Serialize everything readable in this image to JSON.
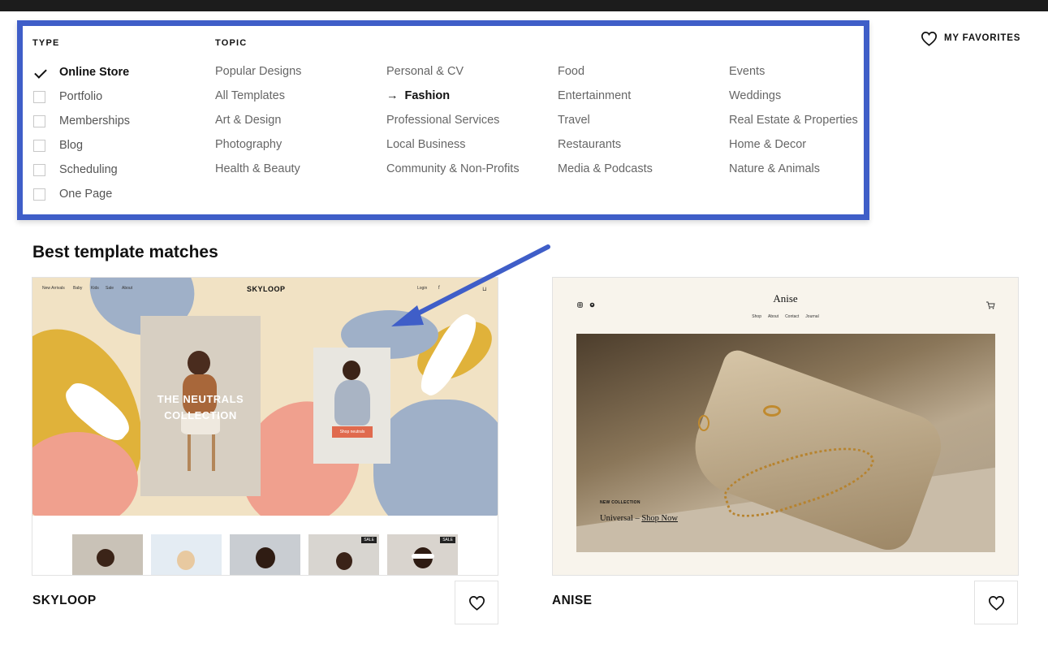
{
  "filters": {
    "type_heading": "TYPE",
    "topic_heading": "TOPIC",
    "type_items": [
      {
        "label": "Online Store",
        "checked": true
      },
      {
        "label": "Portfolio",
        "checked": false
      },
      {
        "label": "Memberships",
        "checked": false
      },
      {
        "label": "Blog",
        "checked": false
      },
      {
        "label": "Scheduling",
        "checked": false
      },
      {
        "label": "One Page",
        "checked": false
      }
    ],
    "topic_columns": [
      [
        "Popular Designs",
        "All Templates",
        "Art & Design",
        "Photography",
        "Health & Beauty"
      ],
      [
        "Personal & CV",
        "Fashion",
        "Professional Services",
        "Local Business",
        "Community & Non-Profits"
      ],
      [
        "Food",
        "Entertainment",
        "Travel",
        "Restaurants",
        "Media & Podcasts"
      ],
      [
        "Events",
        "Weddings",
        "Real Estate & Properties",
        "Home & Decor",
        "Nature & Animals"
      ]
    ],
    "active_topic": "Fashion",
    "active_topic_arrow": "→"
  },
  "header": {
    "favorites_label": "MY FAVORITES"
  },
  "results": {
    "title": "Best template matches",
    "templates": [
      {
        "name": "SKYLOOP",
        "preview": {
          "nav": [
            "New Arrivals",
            "Baby",
            "Kids",
            "Sale",
            "About"
          ],
          "logo": "SKYLOOP",
          "login": "Login",
          "headline": "THE NEUTRALS COLLECTION",
          "button": "Shop neutrals",
          "sale_badge": "SALE"
        }
      },
      {
        "name": "ANISE",
        "preview": {
          "logo": "Anise",
          "nav": [
            "Shop",
            "About",
            "Contact",
            "Journal"
          ],
          "kicker": "NEW COLLECTION",
          "cta_text": "Universal – ",
          "cta_link": "Shop Now"
        }
      }
    ]
  },
  "colors": {
    "highlight_border": "#3f5ec8",
    "topbar": "#1c1c1c"
  }
}
